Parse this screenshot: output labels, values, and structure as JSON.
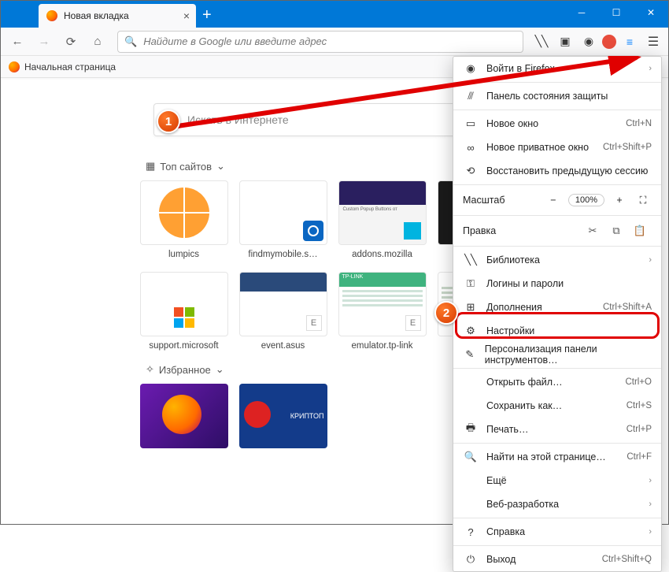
{
  "tab": {
    "title": "Новая вкладка"
  },
  "urlbar": {
    "placeholder": "Найдите в Google или введите адрес"
  },
  "bookmark": {
    "label": "Начальная страница"
  },
  "search": {
    "placeholder": "Искать в Интернете"
  },
  "sections": {
    "top": "Топ сайтов",
    "fav": "Избранное"
  },
  "tiles": {
    "row1": [
      {
        "label": "lumpics"
      },
      {
        "label": "findmymobile.s…"
      },
      {
        "label": "addons.mozilla"
      },
      {
        "label": ""
      }
    ],
    "row2": [
      {
        "label": "support.microsoft"
      },
      {
        "label": "event.asus"
      },
      {
        "label": "emulator.tp-link"
      },
      {
        "label": ""
      }
    ]
  },
  "addons_caption": "Custom Popup Buttons от",
  "fav2_text": "КРИПТОП",
  "menu": {
    "signin": "Войти в Firefox",
    "protection": "Панель состояния защиты",
    "newwin": {
      "label": "Новое окно",
      "shortcut": "Ctrl+N"
    },
    "newpriv": {
      "label": "Новое приватное окно",
      "shortcut": "Ctrl+Shift+P"
    },
    "restore": "Восстановить предыдущую сессию",
    "zoom": {
      "label": "Масштаб",
      "value": "100%"
    },
    "edit": "Правка",
    "library": "Библиотека",
    "logins": "Логины и пароли",
    "addons": {
      "label": "Дополнения",
      "shortcut": "Ctrl+Shift+A"
    },
    "settings": "Настройки",
    "customize": "Персонализация панели инструментов…",
    "open": {
      "label": "Открыть файл…",
      "shortcut": "Ctrl+O"
    },
    "save": {
      "label": "Сохранить как…",
      "shortcut": "Ctrl+S"
    },
    "print": {
      "label": "Печать…",
      "shortcut": "Ctrl+P"
    },
    "find": {
      "label": "Найти на этой странице…",
      "shortcut": "Ctrl+F"
    },
    "more": "Ещё",
    "webdev": "Веб-разработка",
    "help": "Справка",
    "exit": {
      "label": "Выход",
      "shortcut": "Ctrl+Shift+Q"
    }
  },
  "callouts": {
    "one": "1",
    "two": "2"
  }
}
